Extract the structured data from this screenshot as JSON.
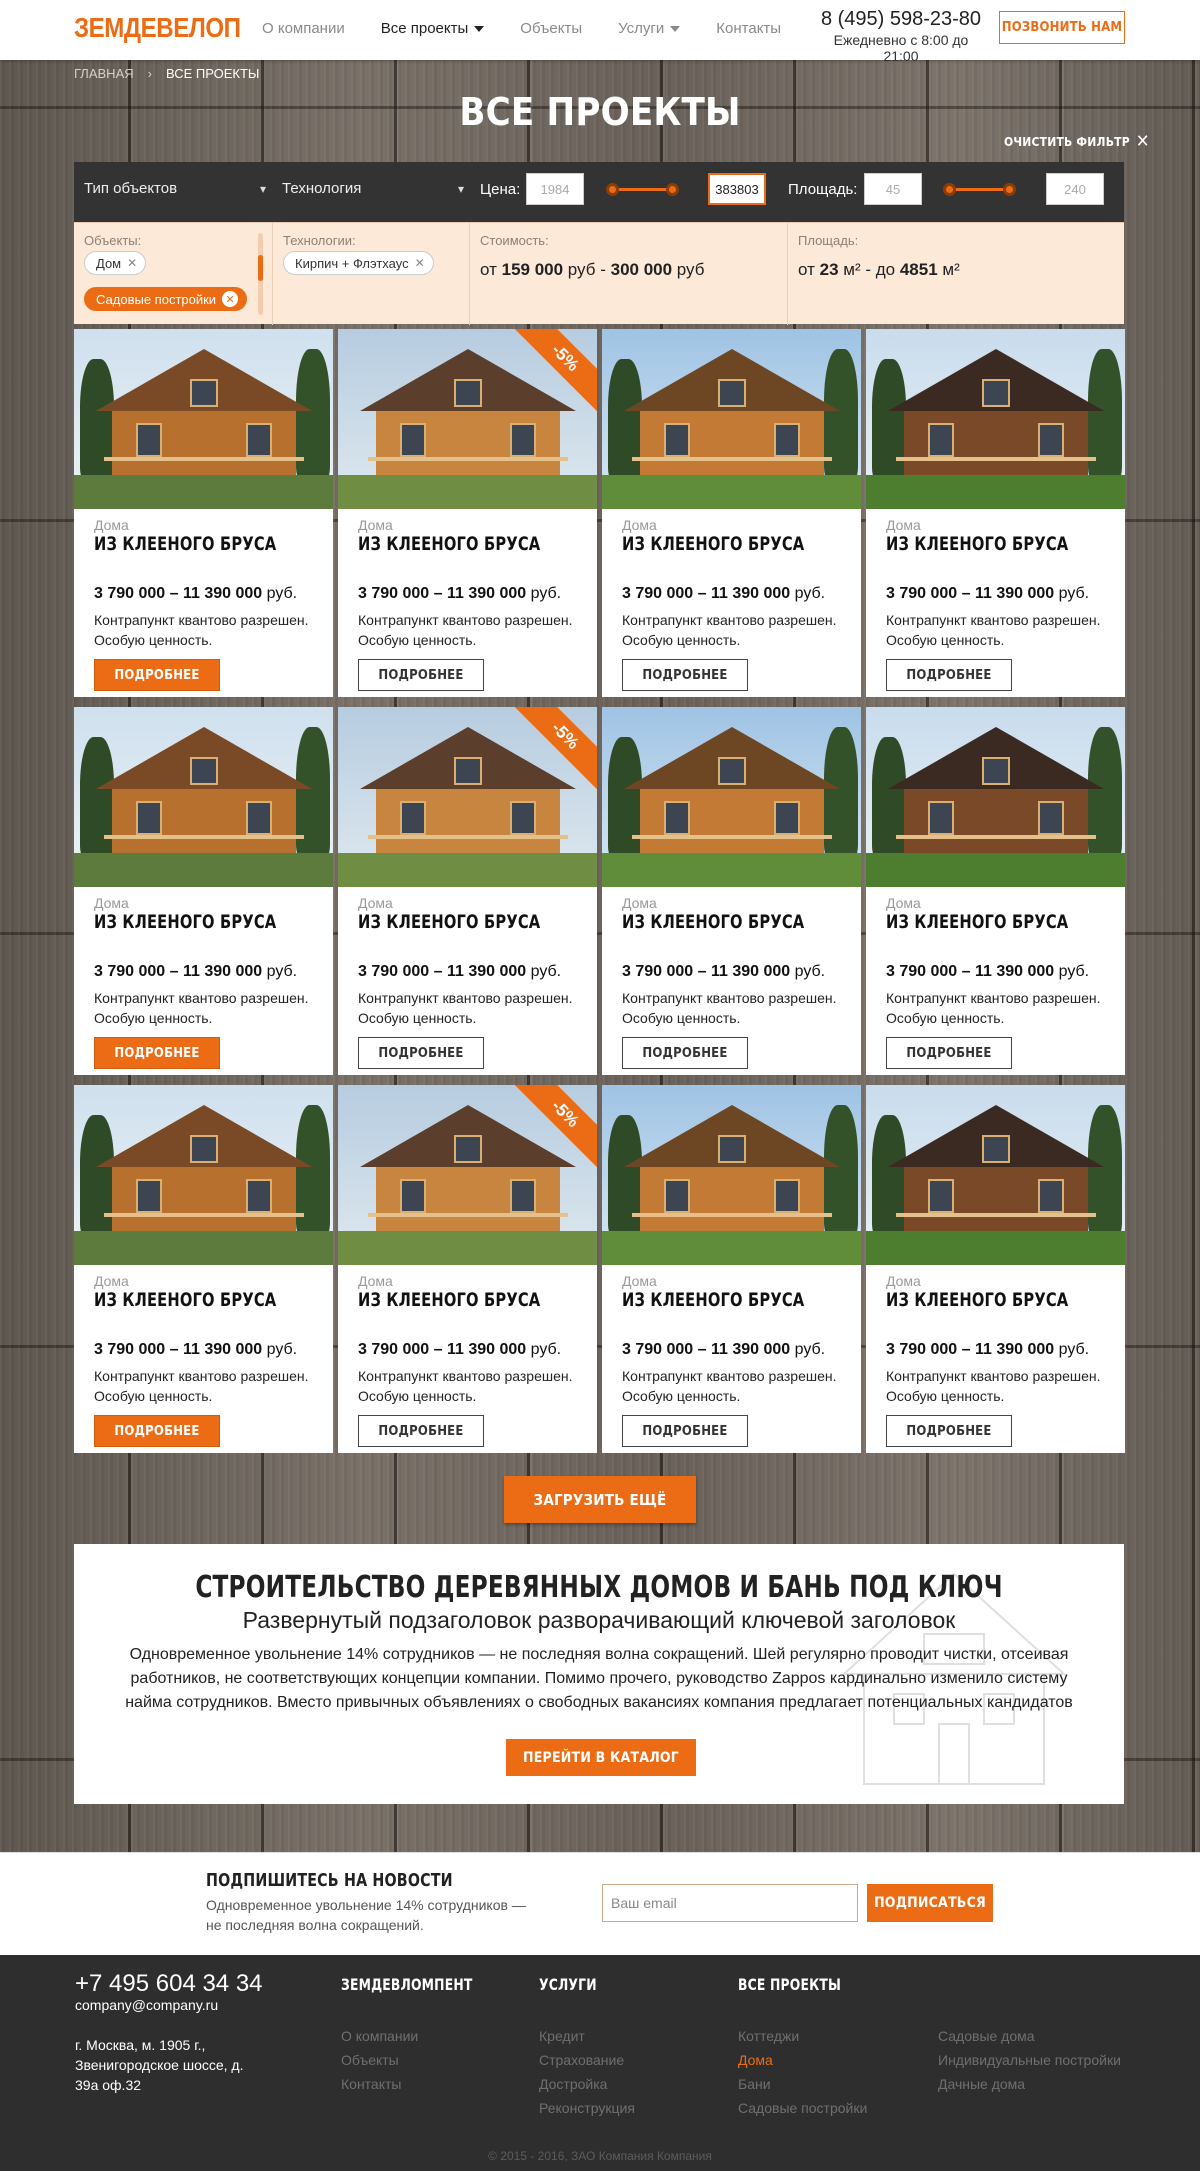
{
  "header": {
    "logo": "ЗЕМДЕВЕЛОП",
    "nav": [
      {
        "label": "О компании",
        "dropdown": false,
        "active": false
      },
      {
        "label": "Все проекты",
        "dropdown": true,
        "active": true
      },
      {
        "label": "Объекты",
        "dropdown": false,
        "active": false
      },
      {
        "label": "Услуги",
        "dropdown": true,
        "active": false
      },
      {
        "label": "Контакты",
        "dropdown": false,
        "active": false
      }
    ],
    "phone": "8 (495) 598-23-80",
    "hours": "Ежедневно с 8:00 до 21:00",
    "call_button": "ПОЗВОНИТЬ НАМ"
  },
  "breadcrumb": {
    "home": "ГЛАВНАЯ",
    "separator": "›",
    "current": "ВСЕ ПРОЕКТЫ"
  },
  "page_title": "ВСЕ ПРОЕКТЫ",
  "clear_filter": "ОЧИСТИТЬ ФИЛЬТР",
  "filter": {
    "type_select": "Тип объектов",
    "tech_select": "Технология",
    "price_label": "Цена:",
    "price_min": "1984",
    "price_max": "383803",
    "area_label": "Площадь:",
    "area_min": "45",
    "area_max": "240"
  },
  "active_filters": {
    "objects_label": "Объекты:",
    "objects_chips": [
      "Дом",
      "Садовые постройки"
    ],
    "tech_label": "Технологии:",
    "tech_chips": [
      "Кирпич + Флэтхаус"
    ],
    "cost_label": "Стоимость:",
    "cost_from_prefix": "от",
    "cost_from": "159 000",
    "cost_mid": "руб -",
    "cost_to": "300 000",
    "cost_unit": "руб",
    "area_label": "Площадь:",
    "area_from_prefix": "от",
    "area_from": "23",
    "area_mid": "м² - до",
    "area_to": "4851",
    "area_unit": "м²"
  },
  "card_template": {
    "category": "Дома",
    "title": "ИЗ КЛЕЕНОГО БРУСА",
    "price_bold": "3 790 000 – 11 390 000",
    "price_unit": "руб.",
    "description": "Контрапункт квантово разрешен. Особую ценность.",
    "button": "ПОДРОБНЕЕ",
    "discount": "-5%"
  },
  "cards": [
    {
      "image": "house-1",
      "discount": false,
      "primary": true
    },
    {
      "image": "house-2",
      "discount": true,
      "primary": false
    },
    {
      "image": "house-3",
      "discount": false,
      "primary": false
    },
    {
      "image": "house-4",
      "discount": false,
      "primary": false
    },
    {
      "image": "house-1",
      "discount": false,
      "primary": true
    },
    {
      "image": "house-2",
      "discount": true,
      "primary": false
    },
    {
      "image": "house-3",
      "discount": false,
      "primary": false
    },
    {
      "image": "house-4",
      "discount": false,
      "primary": false
    },
    {
      "image": "house-1",
      "discount": false,
      "primary": true
    },
    {
      "image": "house-2",
      "discount": true,
      "primary": false
    },
    {
      "image": "house-3",
      "discount": false,
      "primary": false
    },
    {
      "image": "house-4",
      "discount": false,
      "primary": false
    }
  ],
  "load_more": "ЗАГРУЗИТЬ ЕЩЁ",
  "about": {
    "title": "СТРОИТЕЛЬСТВО ДЕРЕВЯННЫХ ДОМОВ И БАНЬ ПОД КЛЮЧ",
    "subtitle": "Развернутый подзаголовок разворачивающий ключевой заголовок",
    "text": "Одновременное увольнение 14% сотрудников — не последняя волна сокращений. Шей регулярно проводит чистки, отсеивая работников, не соответствующих концепции компании. Помимо прочего, руководство Zappos кардинально изменило систему найма сотрудников. Вместо привычных объявлениях о свободных вакансиях компания предлагает потенциальных кандидатов",
    "button": "ПЕРЕЙТИ В КАТАЛОГ"
  },
  "subscribe": {
    "title": "ПОДПИШИТЕСЬ НА НОВОСТИ",
    "text": "Одновременное увольнение 14% сотрудников — не последняя волна сокращений.",
    "email_placeholder": "Ваш email",
    "button": "ПОДПИСАТЬСЯ"
  },
  "footer": {
    "phone": "+7 495 604 34 34",
    "email": "company@company.ru",
    "address": "г. Москва, м. 1905 г., Звенигородское шоссе, д. 39а оф.32",
    "col1": {
      "title": "ЗЕМДЕВЛОМПЕНТ",
      "items": [
        "О компании",
        "Объекты",
        "Контакты"
      ]
    },
    "col2": {
      "title": "УСЛУГИ",
      "items": [
        "Кредит",
        "Страхование",
        "Достройка",
        "Реконструкция"
      ]
    },
    "col3": {
      "title": "ВСЕ ПРОЕКТЫ",
      "items": [
        "Коттеджи",
        "Дома",
        "Бани",
        "Садовые постройки"
      ],
      "highlight": "Дома"
    },
    "col4": {
      "items": [
        "Садовые дома",
        "Индивидуальные постройки",
        "Дачные дома"
      ]
    },
    "copyright": "© 2015 - 2016, ЗАО Компания Компания"
  },
  "colors": {
    "accent": "#ec6c16",
    "dark_bar": "#333333",
    "filter_bg": "#fde9d8",
    "footer": "#2e2e2e"
  }
}
